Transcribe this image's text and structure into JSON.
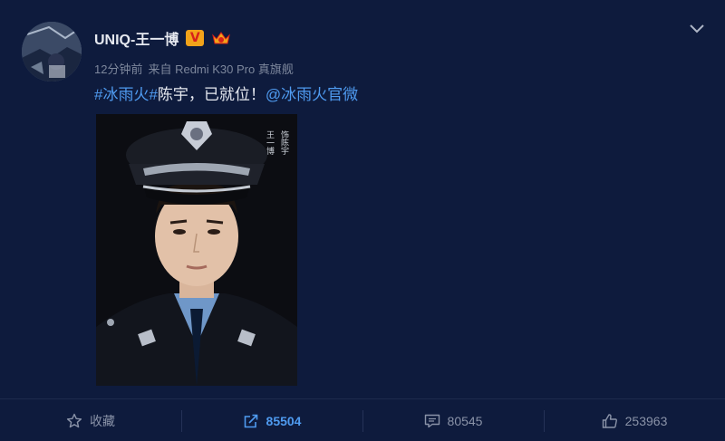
{
  "post": {
    "username": "UNIQ-王一博",
    "verified_badge": "V",
    "meta_time": "12分钟前",
    "meta_source": "来自 Redmi K30 Pro 真旗舰",
    "content": {
      "hashtag": "#冰雨火#",
      "text": "陈宇，已就位！",
      "mention": "@冰雨火官微"
    },
    "image_caption": {
      "left_column": "王一博",
      "right_column": "饰陈宇"
    }
  },
  "actions": [
    {
      "label": "收藏",
      "icon": "star-icon"
    },
    {
      "label": "85504",
      "icon": "share-icon"
    },
    {
      "label": "80545",
      "icon": "comment-icon"
    },
    {
      "label": "253963",
      "icon": "like-icon"
    }
  ],
  "colors": {
    "background": "#0e1b3d",
    "link": "#4f9bf0",
    "text": "#e6e9f0",
    "muted": "#7d879c",
    "badge_bg": "#f2a31a",
    "badge_fg": "#d8211a"
  }
}
